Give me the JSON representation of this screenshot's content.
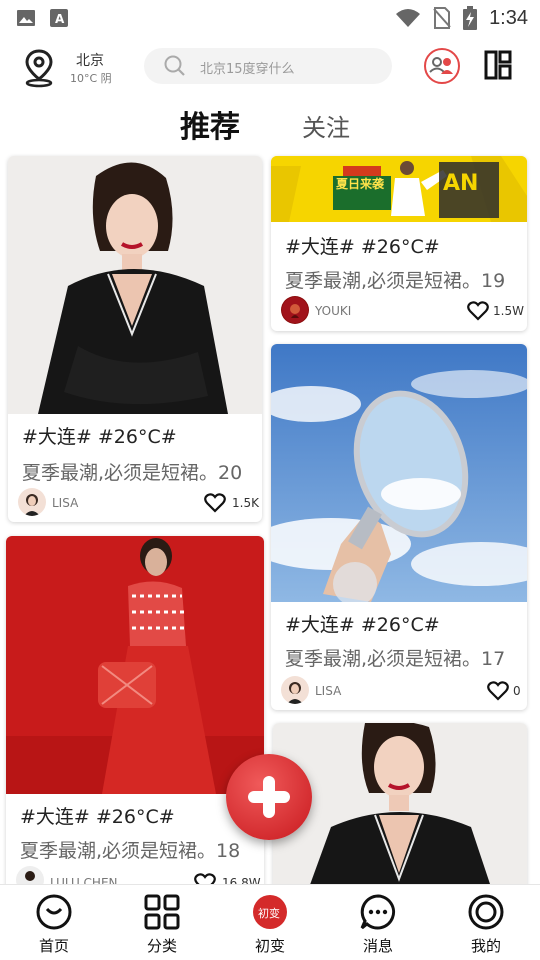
{
  "status_bar": {
    "time": "1:34"
  },
  "header": {
    "city": "北京",
    "weather": "10°C 阴",
    "search_placeholder": "北京15度穿什么"
  },
  "tabs": [
    {
      "label": "推荐",
      "active": true
    },
    {
      "label": "关注",
      "active": false
    }
  ],
  "feed": [
    {
      "tag": "#大连# #26°C#",
      "desc": "夏季最潮,必须是短裙。20",
      "user": "LISA",
      "likes": "1.5K"
    },
    {
      "tag": "#大连# #26°C#",
      "desc": "夏季最潮,必须是短裙。19",
      "user": "YOUKI",
      "likes": "1.5W",
      "banner_text": "夏日来袭"
    },
    {
      "tag": "#大连# #26°C#",
      "desc": "夏季最潮,必须是短裙。17",
      "user": "LISA",
      "likes": "0"
    },
    {
      "tag": "#大连# #26°C#",
      "desc": "夏季最潮,必须是短裙。18",
      "user": "LULU CHEN",
      "likes": "16.8W"
    }
  ],
  "bottom_nav": [
    {
      "label": "首页",
      "icon": "home-face-icon"
    },
    {
      "label": "分类",
      "icon": "grid-icon"
    },
    {
      "label": "初变",
      "icon": "chubian-badge-icon",
      "badge_text": "初变"
    },
    {
      "label": "消息",
      "icon": "chat-icon"
    },
    {
      "label": "我的",
      "icon": "profile-ring-icon"
    }
  ],
  "colors": {
    "accent": "#d42a2a",
    "banner_yellow": "#f6d500"
  }
}
